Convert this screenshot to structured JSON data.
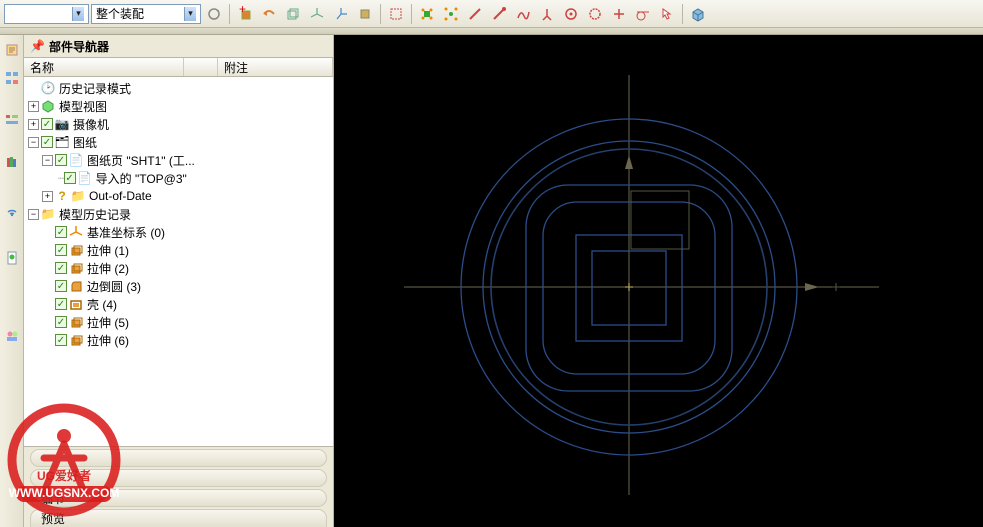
{
  "toolbar": {
    "dropdown1": "",
    "dropdown2": "整个装配"
  },
  "navigator": {
    "title": "部件导航器",
    "col_name": "名称",
    "col_note": "附注",
    "tree": {
      "history_mode": "历史记录模式",
      "model_view": "模型视图",
      "camera": "摄像机",
      "drawings": "图纸",
      "sheet1": "图纸页 \"SHT1\" (工...",
      "imported": "导入的 \"TOP@3\"",
      "outofdate": "Out-of-Date",
      "model_history": "模型历史记录",
      "csys": "基准坐标系 (0)",
      "extrude1": "拉伸 (1)",
      "extrude2": "拉伸 (2)",
      "blend3": "边倒圆 (3)",
      "shell4": "壳 (4)",
      "extrude5": "拉伸 (5)",
      "extrude6": "拉伸 (6)"
    },
    "footer": {
      "p1": "",
      "p2": "",
      "p3": "细节",
      "p4": "预览"
    }
  },
  "watermark": {
    "line1": "UG爱好者",
    "line2": "WWW.UGSNX.COM"
  },
  "icons": {
    "clock": "🕑",
    "cube": "🟩",
    "camera": "📷",
    "folder": "📁",
    "sheet": "📄",
    "import": "📄",
    "q": "?",
    "csys": "✳",
    "extrude": "🟧",
    "blend": "🟧",
    "shell": "🟫"
  }
}
